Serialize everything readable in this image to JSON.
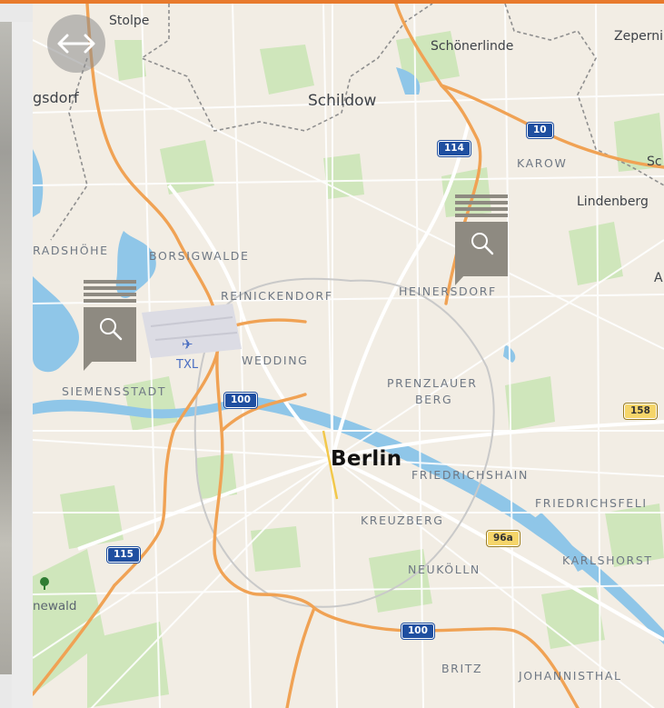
{
  "map": {
    "city": "Berlin",
    "towns": [
      "Stolpe",
      "Schönerlinde",
      "Zeperni",
      "Schildow",
      "Lindenberg",
      "gsdorf",
      "Sc",
      "A"
    ],
    "districts": [
      "KAROW",
      "RADSHÖHE",
      "BORSIGWALDE",
      "REINICKENDORF",
      "HEINERSDORF",
      "WEDDING",
      "SIEMENSSTADT",
      "PRENZLAUER",
      "BERG",
      "FRIEDRICHSHAIN",
      "FRIEDRICHSFELI",
      "KREUZBERG",
      "NEUKÖLLN",
      "KARLSHORST",
      "BRITZ",
      "JOHANNISTHAL",
      "newald"
    ],
    "airport": "TXL",
    "road_shields": {
      "blue": [
        "114",
        "10",
        "100",
        "115",
        "100"
      ],
      "yellow": [
        "158",
        "96a"
      ]
    },
    "colors": {
      "land": "#f2ede4",
      "park": "#c6e3b0",
      "water": "#8fc6e8",
      "highway": "#f0a254",
      "accent_bar": "#e87a2c",
      "marker": "#8e8a81"
    },
    "icons": [
      "swap-horizontal-icon",
      "search-icon",
      "search-icon",
      "airplane-icon",
      "tree-icon"
    ]
  }
}
